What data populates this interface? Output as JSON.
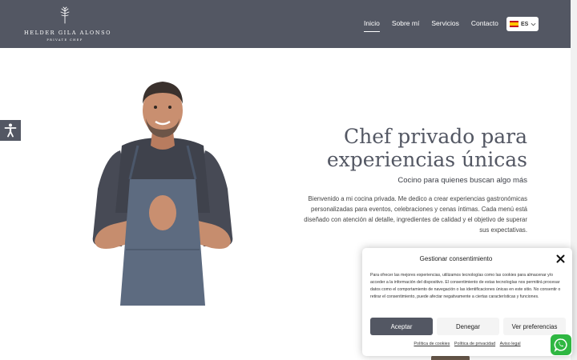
{
  "header": {
    "logo_name": "HELDER GILA ALONSO",
    "logo_sub": "PRIVATE CHEF",
    "nav": [
      {
        "label": "Inicio",
        "active": true
      },
      {
        "label": "Sobre mí",
        "active": false
      },
      {
        "label": "Servicios",
        "active": false
      },
      {
        "label": "Contacto",
        "active": false
      }
    ],
    "language": {
      "code": "ES",
      "flag": "spain-flag-icon"
    }
  },
  "hero": {
    "title_line1": "Chef privado para",
    "title_line2": "experiencias únicas",
    "subtitle": "Cocino para quienes buscan algo más",
    "body": "Bienvenido a mi cocina privada. Me dedico a crear experiencias gastronómicas personalizadas para eventos, celebraciones y cenas íntimas. Cada menú está diseñado con atención al detalle, ingredientes de calidad y el objetivo de superar sus expectativas."
  },
  "cookie": {
    "title": "Gestionar consentimiento",
    "text": "Para ofrecer las mejores experiencias, utilizamos tecnologías como las cookies para almacenar y/o acceder a la información del dispositivo. El consentimiento de estas tecnologías nos permitirá procesar datos como el comportamiento de navegación o las identificaciones únicas en este sitio. No consentir o retirar el consentimiento, puede afectar negativamente a ciertas características y funciones.",
    "accept_label": "Aceptar",
    "deny_label": "Denegar",
    "prefs_label": "Ver preferencias",
    "links": [
      "Política de cookies",
      "Política de privacidad",
      "Aviso legal"
    ]
  },
  "colors": {
    "header_bg": "#535763",
    "accent": "#535763",
    "whatsapp": "#2fb742"
  },
  "icons": [
    "accessibility-icon",
    "close-icon",
    "whatsapp-icon",
    "chevron-down-icon",
    "logo-sprig-icon"
  ]
}
